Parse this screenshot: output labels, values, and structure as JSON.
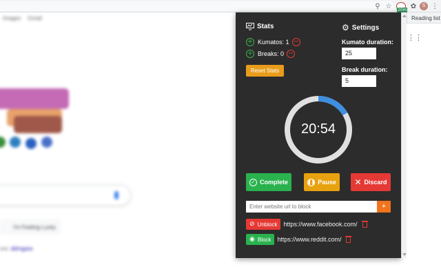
{
  "browser": {
    "reading_list_label": "Reading list",
    "profile_initial": "S",
    "extension_badge": "20m",
    "icons": [
      "location-icon",
      "star-icon",
      "puzzle-icon",
      "more-vert-icon",
      "apps-grid-icon"
    ]
  },
  "background_page": {
    "top_links": [
      "Images",
      "Gmail"
    ],
    "lucky_button": "I'm Feeling Lucky",
    "offered_in_prefix": "ers:",
    "offered_in_link": "dd/ngara"
  },
  "stats": {
    "title": "Stats",
    "kumatos_label": "Kumatos: 1",
    "breaks_label": "Breaks: 0",
    "reset_label": "Reset Stats"
  },
  "settings": {
    "title": "Settings",
    "kumato_duration_label": "Kumato duration:",
    "kumato_duration_value": "25",
    "break_duration_label": "Break duration:",
    "break_duration_value": "5"
  },
  "timer": {
    "display": "20:54",
    "progress_fraction": 0.165,
    "track_color": "#e0e0e0",
    "progress_color": "#3d8fe0"
  },
  "actions": {
    "complete_label": "Complete",
    "pause_label": "Pause",
    "discard_label": "Discard"
  },
  "blocker": {
    "url_placeholder": "Enter website url to block",
    "add_label": "+",
    "sites": [
      {
        "button_label": "Unblock",
        "url": "https://www.facebook.com/",
        "state": "blocked"
      },
      {
        "button_label": "Block",
        "url": "https://www.reddit.com/",
        "state": "unblocked"
      }
    ]
  },
  "colors": {
    "popup_bg": "#2c2c2c",
    "green": "#2ab24f",
    "orange": "#e8a20f",
    "red": "#e53935",
    "blue": "#3d8fe0"
  }
}
